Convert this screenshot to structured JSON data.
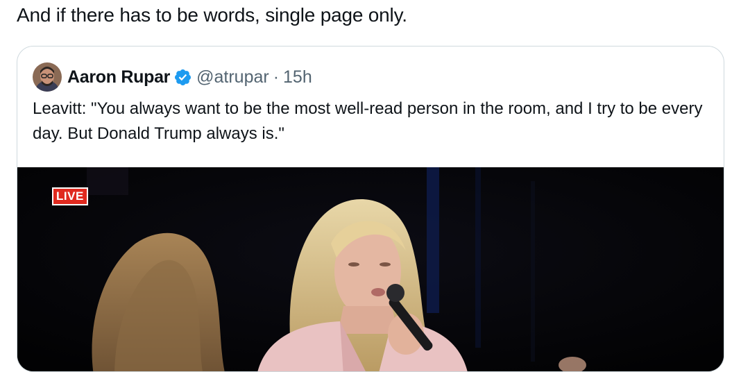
{
  "tweet": {
    "text": "And if there has to be words, single page only."
  },
  "quoted_tweet": {
    "author_name": "Aaron Rupar",
    "handle": "@atrupar",
    "separator": "·",
    "timestamp": "15h",
    "verified": true,
    "body": "Leavitt: \"You always want to be the most well-read person in the room, and I try to be every day. But Donald Trump always is.\"",
    "media": {
      "badge": "LIVE"
    }
  },
  "colors": {
    "text_primary": "#0f1419",
    "text_secondary": "#536471",
    "verified_blue": "#1d9bf0",
    "border": "#cfd9de",
    "live_red": "#e02a1f"
  },
  "icons": [
    "avatar",
    "verified-badge-icon"
  ]
}
